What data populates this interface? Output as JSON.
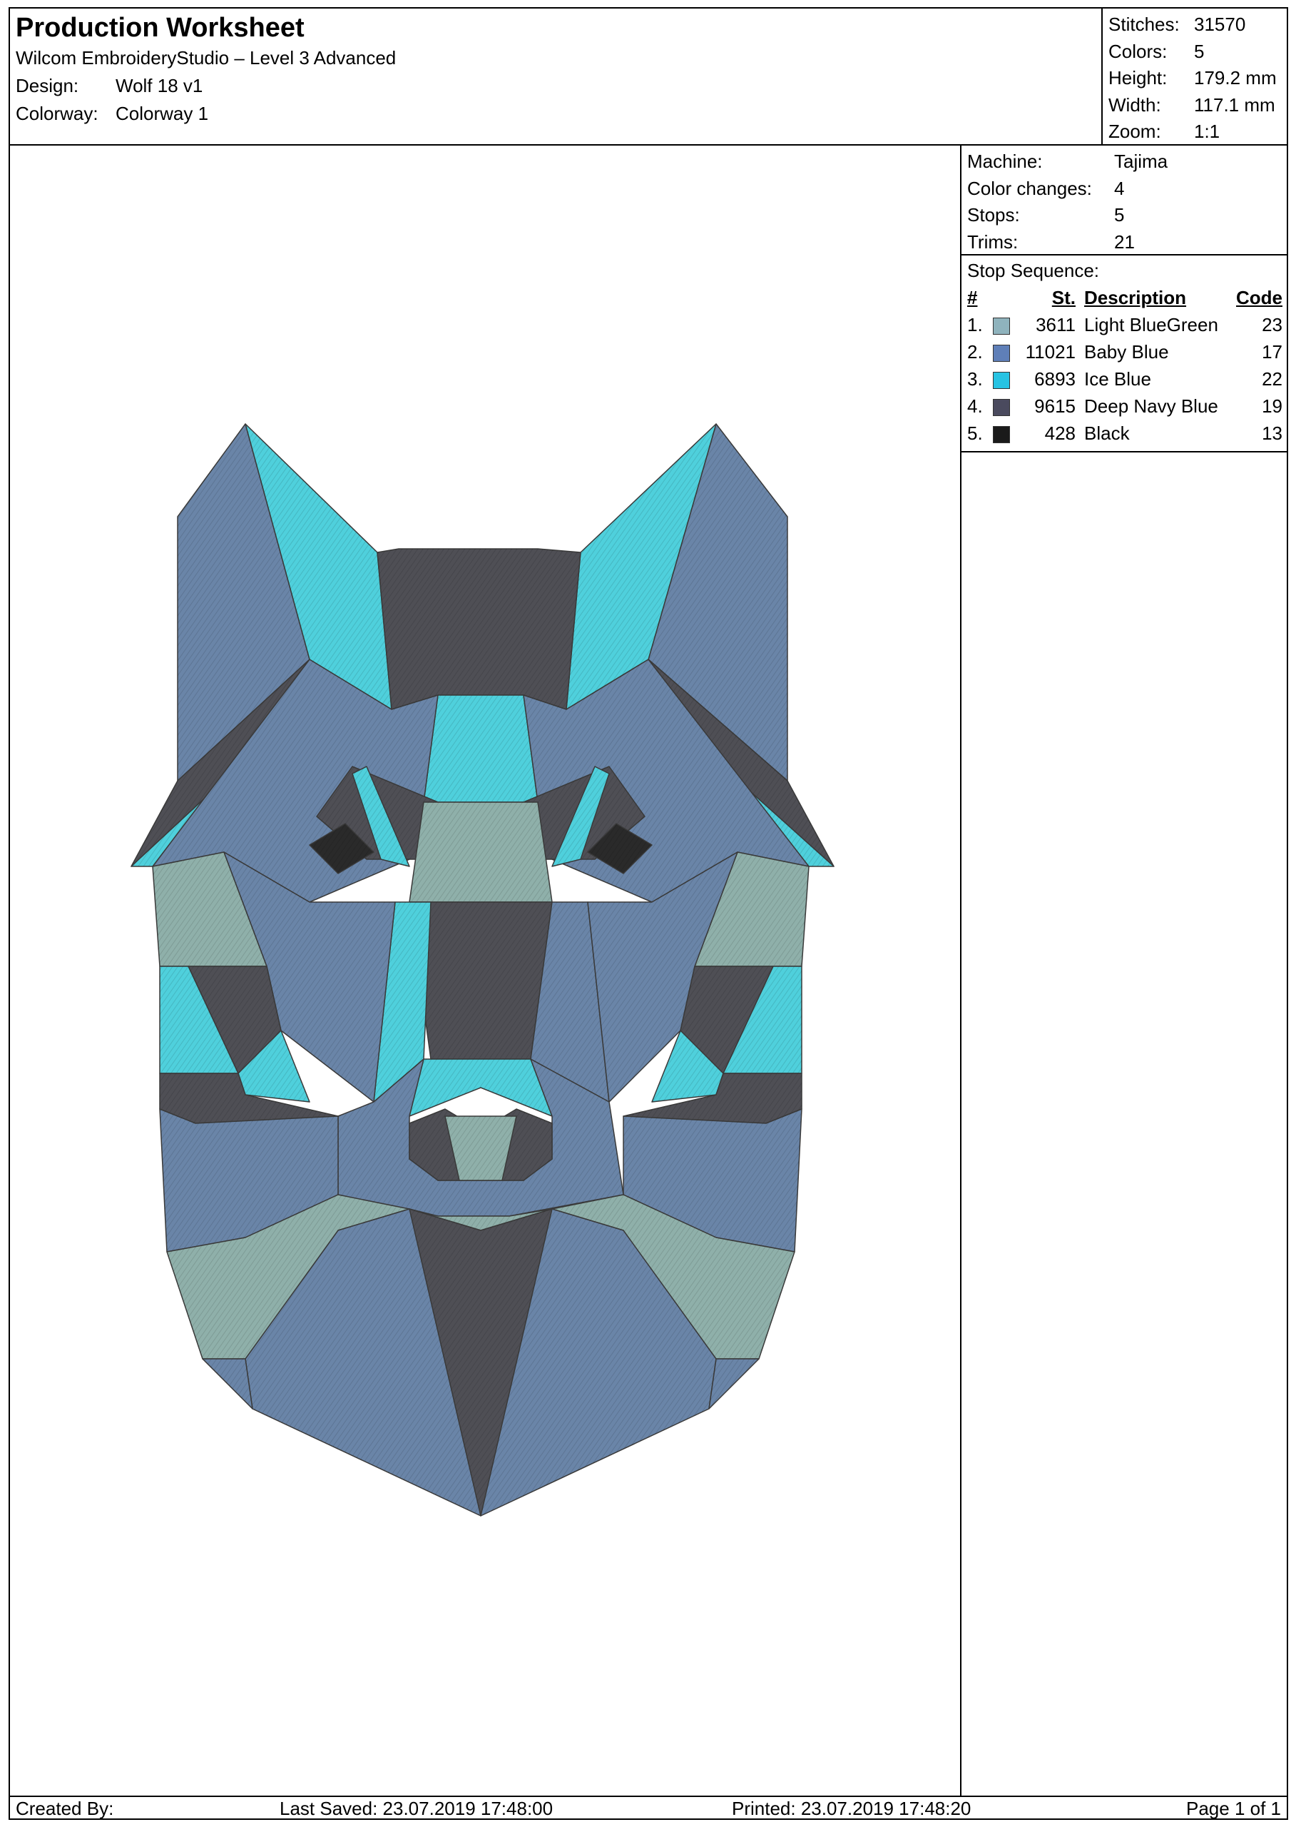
{
  "header": {
    "title": "Production Worksheet",
    "software": "Wilcom EmbroideryStudio – Level 3 Advanced",
    "design_label": "Design:",
    "design_value": "Wolf 18 v1",
    "colorway_label": "Colorway:",
    "colorway_value": "Colorway 1"
  },
  "stats": {
    "stitches_label": "Stitches:",
    "stitches": "31570",
    "colors_label": "Colors:",
    "colors": "5",
    "height_label": "Height:",
    "height": "179.2 mm",
    "width_label": "Width:",
    "width": "117.1 mm",
    "zoom_label": "Zoom:",
    "zoom": "1:1"
  },
  "machine": {
    "machine_label": "Machine:",
    "machine": "Tajima",
    "color_changes_label": "Color changes:",
    "color_changes": "4",
    "stops_label": "Stops:",
    "stops": "5",
    "trims_label": "Trims:",
    "trims": "21"
  },
  "stop_sequence": {
    "title": "Stop Sequence:",
    "col_num": "#",
    "col_st": "St.",
    "col_desc": "Description",
    "col_code": "Code",
    "rows": [
      {
        "num": "1.",
        "swatch": "#8fb3bd",
        "st": "3611",
        "desc": "Light BlueGreen",
        "code": "23"
      },
      {
        "num": "2.",
        "swatch": "#5f7fb8",
        "st": "11021",
        "desc": "Baby Blue",
        "code": "17"
      },
      {
        "num": "3.",
        "swatch": "#27c3e3",
        "st": "6893",
        "desc": "Ice Blue",
        "code": "22"
      },
      {
        "num": "4.",
        "swatch": "#4a4a5e",
        "st": "9615",
        "desc": "Deep Navy Blue",
        "code": "19"
      },
      {
        "num": "5.",
        "swatch": "#1a1a1a",
        "st": "428",
        "desc": "Black",
        "code": "13"
      }
    ]
  },
  "footer": {
    "created_by": "Created By:",
    "last_saved": "Last Saved: 23.07.2019 17:48:00",
    "printed": "Printed: 23.07.2019 17:48:20",
    "page": "Page 1 of 1"
  },
  "art_colors": {
    "blue": "#6a85a8",
    "aqua": "#4fd0dc",
    "dark": "#4f4f55",
    "mint": "#8fb0aa",
    "black": "#2a2a2a"
  }
}
